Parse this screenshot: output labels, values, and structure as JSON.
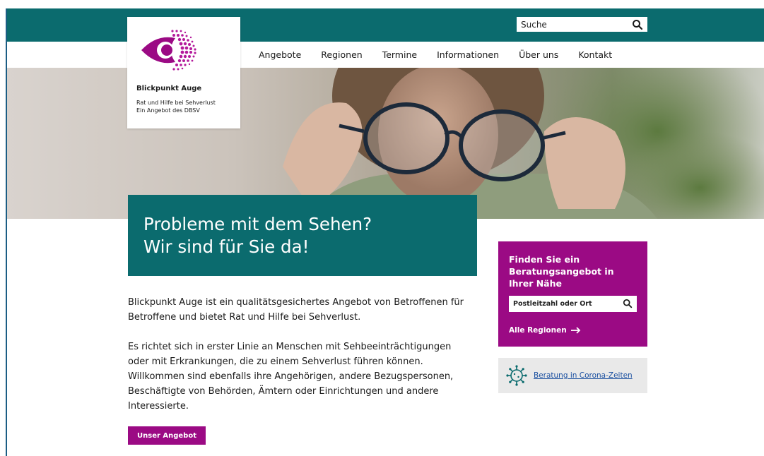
{
  "brand": {
    "name": "Blickpunkt Auge",
    "tagline_line1": "Rat und Hilfe bei Sehverlust",
    "tagline_line2": "Ein Angebot des DBSV",
    "accent_teal": "#0b6b6e",
    "accent_magenta": "#9b0a84"
  },
  "search": {
    "placeholder": "Suche",
    "icon": "search-icon"
  },
  "nav": {
    "items": [
      {
        "label": "Angebote"
      },
      {
        "label": "Regionen"
      },
      {
        "label": "Termine"
      },
      {
        "label": "Informationen"
      },
      {
        "label": "Über uns"
      },
      {
        "label": "Kontakt"
      }
    ]
  },
  "hero": {
    "headline_line1": "Probleme mit dem Sehen?",
    "headline_line2": "Wir sind für Sie da!"
  },
  "main": {
    "intro": "Blickpunkt Auge ist ein qualitätsgesichertes Angebot von Betroffenen für Betroffene und bietet Rat und Hilfe bei Sehverlust.",
    "body": "Es richtet sich in erster Linie an Menschen mit Sehbeeinträchtigungen oder mit Erkrankungen, die zu einem Sehverlust führen können. Willkommen sind ebenfalls ihre Angehörigen, andere Bezugspersonen, Beschäftigte von Behörden, Ämtern oder Einrichtungen und andere Interessierte.",
    "cta_label": "Unser Angebot"
  },
  "finder": {
    "title": "Finden Sie ein Beratungsangebot in Ihrer Nähe",
    "input_placeholder": "Postleitzahl oder Ort",
    "link_label": "Alle Regionen",
    "link_icon": "arrow-right-icon"
  },
  "corona": {
    "link_label": "Beratung in Corona-Zeiten",
    "icon": "virus-icon"
  }
}
